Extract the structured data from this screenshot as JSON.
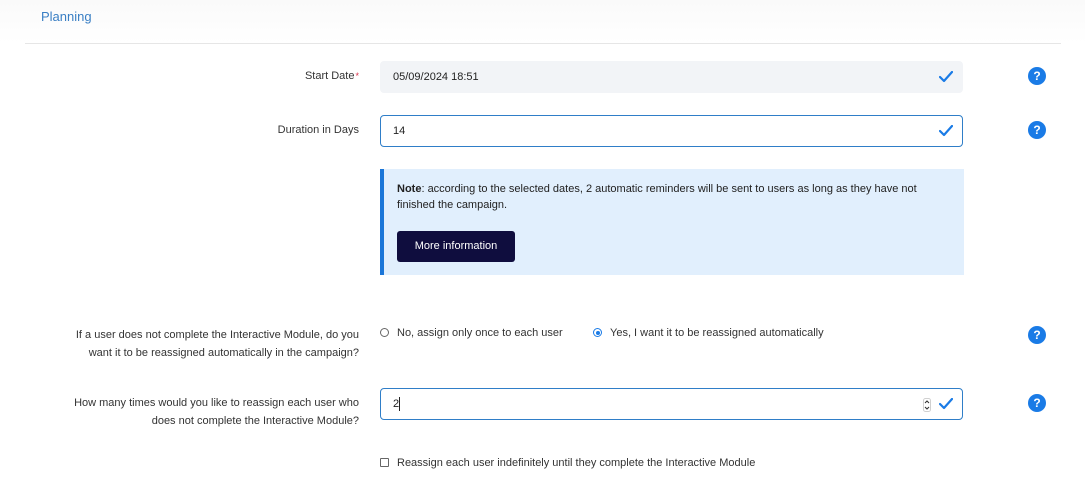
{
  "section": {
    "title": "Planning"
  },
  "start_date": {
    "label": "Start Date",
    "required_mark": "*",
    "value": "05/09/2024 18:51"
  },
  "duration": {
    "label": "Duration in Days",
    "value": "14"
  },
  "note": {
    "bold": "Note",
    "text": ": according to the selected dates, 2 automatic reminders will be sent to users as long as they have not finished the campaign.",
    "button_label": "More information"
  },
  "reassign": {
    "label_line1": "If a user does not complete the Interactive Module, do you",
    "label_line2": "want it to be reassigned automatically in the campaign?",
    "options": [
      {
        "label": "No, assign only once to each user",
        "checked": false
      },
      {
        "label": "Yes, I want it to be reassigned automatically",
        "checked": true
      }
    ]
  },
  "reassign_times": {
    "label_line1": "How many times would you like to reassign each user who",
    "label_line2": "does not complete the Interactive Module?",
    "value": "2"
  },
  "indefinite": {
    "label": "Reassign each user indefinitely until they complete the Interactive Module",
    "checked": false
  },
  "help": {
    "glyph": "?"
  },
  "colors": {
    "accent": "#1a7be6",
    "note_bg": "#e1effd",
    "button_bg": "#0f0d3e",
    "check": "#1a7be6"
  }
}
